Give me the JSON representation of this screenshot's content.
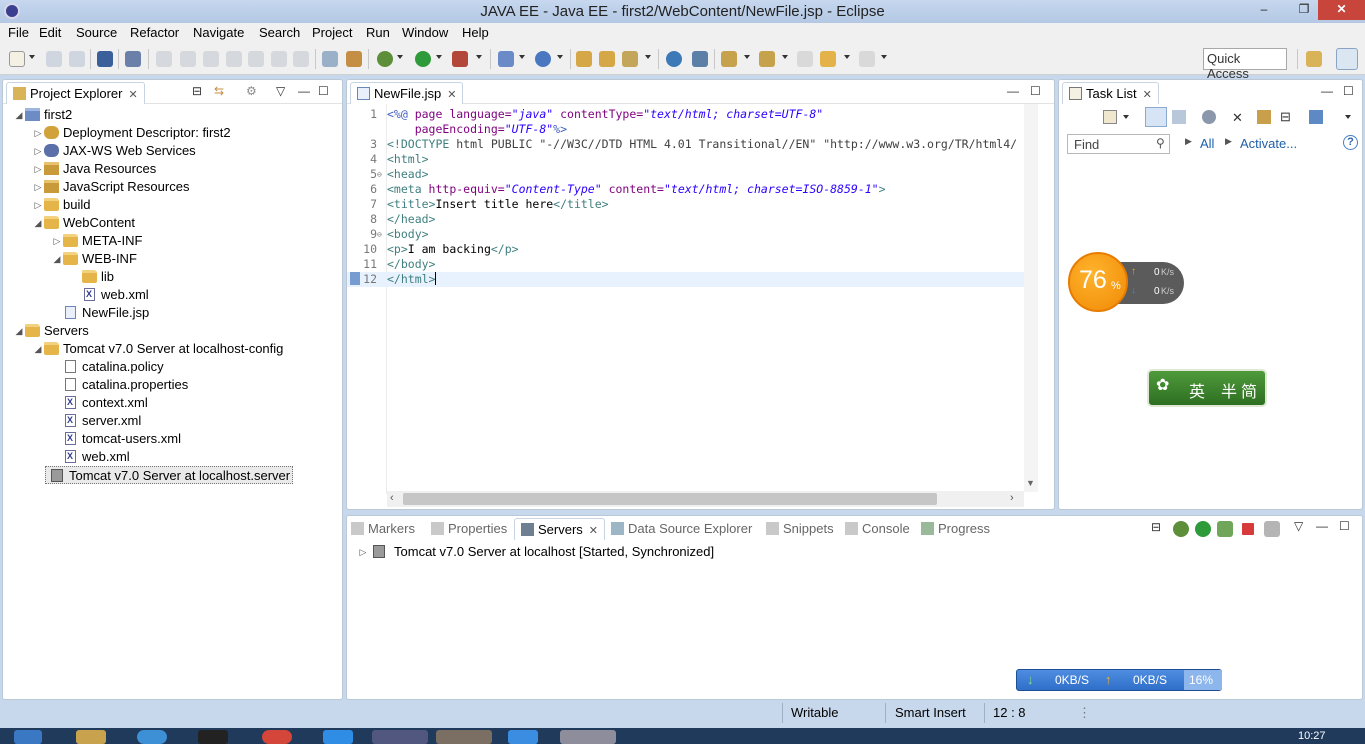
{
  "window": {
    "title": "JAVA EE - Java EE - first2/WebContent/NewFile.jsp - Eclipse",
    "minimize": "–",
    "maximize": "❐",
    "close": "✕"
  },
  "menu": [
    "File",
    "Edit",
    "Source",
    "Refactor",
    "Navigate",
    "Search",
    "Project",
    "Run",
    "Window",
    "Help"
  ],
  "toolbar": {
    "quick_access": "Quick Access"
  },
  "project_explorer": {
    "title": "Project Explorer",
    "items": [
      {
        "label": "first2",
        "arrow": "◢",
        "icon": "project-icon"
      },
      {
        "label": "Deployment Descriptor: first2",
        "arrow": "▷",
        "icon": "descriptor-icon"
      },
      {
        "label": "JAX-WS Web Services",
        "arrow": "▷",
        "icon": "webservices-icon"
      },
      {
        "label": "Java Resources",
        "arrow": "▷",
        "icon": "java-resources-icon"
      },
      {
        "label": "JavaScript Resources",
        "arrow": "▷",
        "icon": "javascript-resources-icon"
      },
      {
        "label": "build",
        "arrow": "▷",
        "icon": "folder-icon"
      },
      {
        "label": "WebContent",
        "arrow": "◢",
        "icon": "folder-icon"
      },
      {
        "label": "META-INF",
        "arrow": "▷",
        "icon": "folder-icon"
      },
      {
        "label": "WEB-INF",
        "arrow": "◢",
        "icon": "folder-icon"
      },
      {
        "label": "lib",
        "arrow": "",
        "icon": "folder-icon"
      },
      {
        "label": "web.xml",
        "arrow": "",
        "icon": "xml-file-icon"
      },
      {
        "label": "NewFile.jsp",
        "arrow": "",
        "icon": "jsp-file-icon"
      },
      {
        "label": "Servers",
        "arrow": "◢",
        "icon": "folder-icon"
      },
      {
        "label": "Tomcat v7.0 Server at localhost-config",
        "arrow": "◢",
        "icon": "folder-icon"
      },
      {
        "label": "catalina.policy",
        "arrow": "",
        "icon": "file-icon"
      },
      {
        "label": "catalina.properties",
        "arrow": "",
        "icon": "file-icon"
      },
      {
        "label": "context.xml",
        "arrow": "",
        "icon": "xml-file-icon"
      },
      {
        "label": "server.xml",
        "arrow": "",
        "icon": "xml-file-icon"
      },
      {
        "label": "tomcat-users.xml",
        "arrow": "",
        "icon": "xml-file-icon"
      },
      {
        "label": "web.xml",
        "arrow": "",
        "icon": "xml-file-icon"
      },
      {
        "label": "Tomcat v7.0 Server at localhost.server",
        "arrow": "",
        "icon": "server-file-icon"
      }
    ]
  },
  "editor": {
    "tab": "NewFile.jsp",
    "lines": [
      {
        "n": "1",
        "fold": "",
        "segments": [
          [
            "t-dir",
            "<%@ "
          ],
          [
            "t-attr",
            "page "
          ],
          [
            "t-attr",
            "language="
          ],
          [
            "t-val",
            "\"java\""
          ],
          [
            "t-attr",
            " contentType="
          ],
          [
            "t-val",
            "\"text/html; charset=UTF-8\""
          ]
        ]
      },
      {
        "n": "",
        "fold": "",
        "segments": [
          [
            "t-attr",
            "    pageEncoding="
          ],
          [
            "t-val",
            "\"UTF-8\""
          ],
          [
            "t-dir",
            "%>"
          ]
        ]
      },
      {
        "n": "3",
        "fold": "",
        "segments": [
          [
            "t-tag",
            "<!DOCTYPE "
          ],
          [
            "t-doc",
            "html PUBLIC \"-//W3C//DTD HTML 4.01 Transitional//EN\" \"http://www.w3.org/TR/html4/"
          ]
        ]
      },
      {
        "n": "4",
        "fold": "",
        "segments": [
          [
            "t-tag",
            "<html>"
          ]
        ]
      },
      {
        "n": "5",
        "fold": "⊖",
        "segments": [
          [
            "t-tag",
            "<head>"
          ]
        ]
      },
      {
        "n": "6",
        "fold": "",
        "segments": [
          [
            "t-tag",
            "<meta "
          ],
          [
            "t-attr",
            "http-equiv="
          ],
          [
            "t-val",
            "\"Content-Type\""
          ],
          [
            "t-attr",
            " content="
          ],
          [
            "t-val",
            "\"text/html; charset=ISO-8859-1\""
          ],
          [
            "t-tag",
            ">"
          ]
        ]
      },
      {
        "n": "7",
        "fold": "",
        "segments": [
          [
            "t-tag",
            "<title>"
          ],
          [
            "t-text",
            "Insert title here"
          ],
          [
            "t-tag",
            "</title>"
          ]
        ]
      },
      {
        "n": "8",
        "fold": "",
        "segments": [
          [
            "t-tag",
            "</head>"
          ]
        ]
      },
      {
        "n": "9",
        "fold": "⊖",
        "segments": [
          [
            "t-tag",
            "<body>"
          ]
        ]
      },
      {
        "n": "10",
        "fold": "",
        "segments": [
          [
            "t-tag",
            "<p>"
          ],
          [
            "t-text",
            "I am backing"
          ],
          [
            "t-tag",
            "</p>"
          ]
        ]
      },
      {
        "n": "11",
        "fold": "",
        "segments": [
          [
            "t-tag",
            "</body>"
          ]
        ]
      },
      {
        "n": "12",
        "fold": "",
        "segments": [
          [
            "t-tag",
            "</html>"
          ]
        ]
      }
    ]
  },
  "task_list": {
    "title": "Task List",
    "find_placeholder": "Find",
    "all_label": "All",
    "activate_label": "Activate...",
    "help": "?"
  },
  "net_widget": {
    "percent": "76",
    "percent_unit": "%",
    "up": "0",
    "down": "0",
    "unit": "K/s"
  },
  "ime_widget": {
    "label_en": "英",
    "label_mode": "半",
    "label_simp": "简"
  },
  "bottom_panel": {
    "tabs": [
      "Markers",
      "Properties",
      "Servers",
      "Data Source Explorer",
      "Snippets",
      "Console",
      "Progress"
    ],
    "active_tab": "Servers",
    "server_row": "Tomcat v7.0 Server at localhost  [Started, Synchronized]"
  },
  "speed_bar": {
    "down": "0KB/S",
    "up": "0KB/S",
    "cpu": "16%"
  },
  "status_bar": {
    "writable": "Writable",
    "insert_mode": "Smart Insert",
    "position": "12 : 8"
  },
  "taskbar": {
    "clock": "10:27"
  }
}
